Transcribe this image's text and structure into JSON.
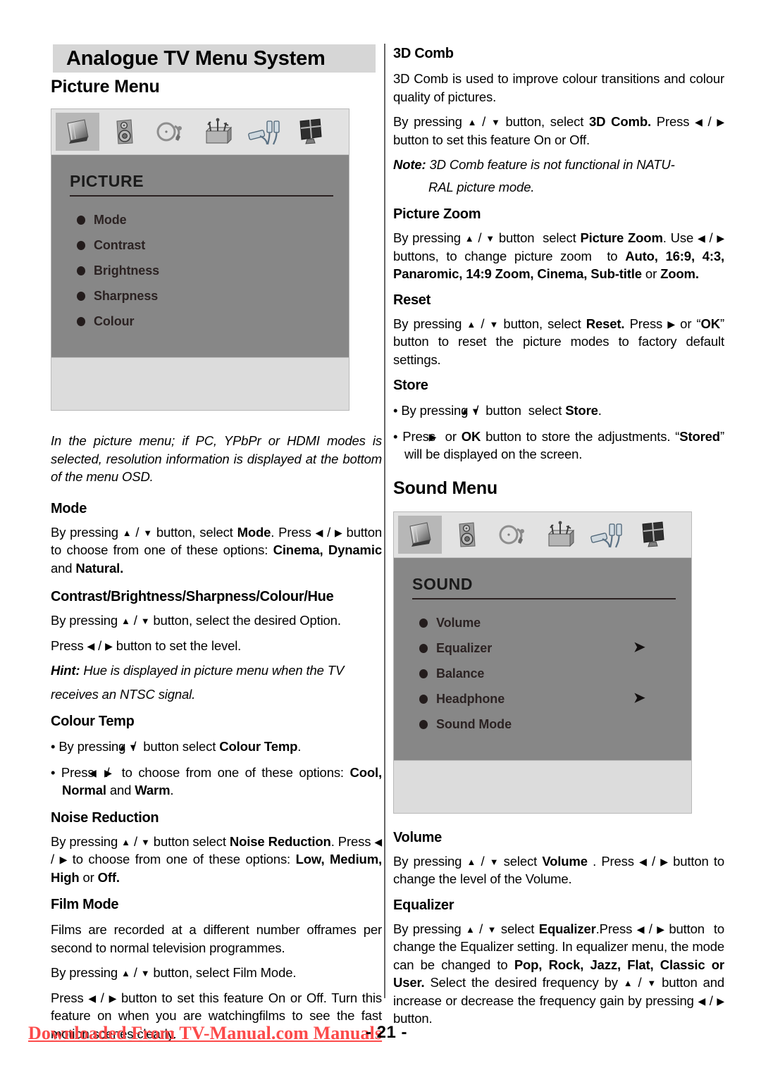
{
  "page": {
    "chapter_title": "Analogue TV Menu System",
    "page_number": "- 21 -",
    "footer_link": "Downloaded From TV-Manual.com Manuals",
    "footer_link_color": "#fc4a4a"
  },
  "left_column": {
    "section_title": "Picture Menu",
    "osd": {
      "title": "PICTURE",
      "items": [
        {
          "label": "Mode",
          "submenu": false
        },
        {
          "label": "Contrast",
          "submenu": false
        },
        {
          "label": "Brightness",
          "submenu": false
        },
        {
          "label": "Sharpness",
          "submenu": false
        },
        {
          "label": "Colour",
          "submenu": false
        }
      ],
      "icons": [
        "picture-icon",
        "sound-icon",
        "feature-icon",
        "install-icon",
        "source-icon",
        "pc-icon"
      ],
      "selected_icon_index": 0,
      "body_color": "#878787",
      "footer_color": "#dcdcdc"
    },
    "intro_note": "In the picture menu; if PC, YPbPr or HDMI modes is selected, resolution information is displayed at the bottom of the menu OSD.",
    "blocks": [
      {
        "heading": "Mode",
        "paragraphs": [
          "By pressing ▲ / ▼ button, select Mode. Press ◀ / ▶ button to choose from one of these options: Cinema, Dynamic and Natural."
        ]
      },
      {
        "heading": "Contrast/Brightness/Sharpness/Colour/Hue",
        "paragraphs": [
          "By pressing ▲ / ▼ button, select the desired Option.",
          "Press ◀ / ▶ button to set the level.",
          "Hint: Hue is displayed in picture menu when the TV receives an NTSC signal."
        ]
      },
      {
        "heading": "Colour Temp",
        "paragraphs": [
          "• By pressing ▲ / ▼ button select Colour Temp.",
          "• Press ◀ / ▶ to choose from one of these options: Cool, Normal and Warm."
        ]
      },
      {
        "heading": "Noise Reduction",
        "paragraphs": [
          "By pressing ▲ / ▼ button select Noise Reduction. Press ◀ / ▶ to choose from one of these options: Low, Medium, High or Off."
        ]
      },
      {
        "heading": "Film Mode",
        "paragraphs": [
          "Films are recorded at a different number offrames per second to normal television programmes.",
          "By pressing ▲ / ▼ button, select Film Mode.",
          "Press ◀ / ▶ button to set this feature On or Off. Turn this feature on when you are watchingfilms to see the fast motion scenes clearly."
        ]
      }
    ]
  },
  "right_column": {
    "blocks_top": [
      {
        "heading": "3D Comb",
        "paragraphs": [
          "3D Comb is used to improve colour transitions and colour quality of  pictures.",
          "By pressing ▲ / ▼ button, select 3D Comb. Press ◀ / ▶ button to set this feature On or Off.",
          "Note: 3D Comb feature is not functional in NATU-RAL picture mode."
        ]
      },
      {
        "heading": "Picture Zoom",
        "paragraphs": [
          "By pressing ▲ / ▼ button  select Picture Zoom. Use ◀ / ▶ buttons, to change picture zoom  to Auto, 16:9, 4:3, Panaromic, 14:9 Zoom, Cinema, Subtitle or Zoom."
        ]
      },
      {
        "heading": "Reset",
        "paragraphs": [
          "By pressing ▲ / ▼ button, select Reset. Press ▶ or “OK” button to reset the picture modes to factory default settings."
        ]
      },
      {
        "heading": "Store",
        "paragraphs": [
          "• By pressing ▲ / ▼ button  select Store.",
          "• Press ▶ or OK button to store the adjustments. “Stored” will be displayed on the screen."
        ]
      }
    ],
    "section_title": "Sound Menu",
    "osd": {
      "title": "SOUND",
      "items": [
        {
          "label": "Volume",
          "submenu": false
        },
        {
          "label": "Equalizer",
          "submenu": true
        },
        {
          "label": "Balance",
          "submenu": false
        },
        {
          "label": "Headphone",
          "submenu": true
        },
        {
          "label": "Sound Mode",
          "submenu": false
        }
      ],
      "icons": [
        "picture-icon",
        "sound-icon",
        "feature-icon",
        "install-icon",
        "source-icon",
        "pc-icon"
      ],
      "selected_icon_index": 0,
      "body_color": "#878787",
      "footer_color": "#dcdcdc"
    },
    "blocks_bottom": [
      {
        "heading": "Volume",
        "paragraphs": [
          "By pressing ▲ / ▼ select Volume . Press ◀ / ▶ button to change the level of the Volume."
        ]
      },
      {
        "heading": "Equalizer",
        "paragraphs": [
          "By pressing ▲ / ▼ select Equalizer.Press ◀ / ▶ button  to change the Equalizer setting. In equalizer menu, the mode can be changed to Pop, Rock, Jazz, Flat, Classic or User. Select the desired frequency by ▲ / ▼ button and increase or decrease the frequency gain by pressing ◀ / ▶ button."
        ]
      }
    ]
  }
}
